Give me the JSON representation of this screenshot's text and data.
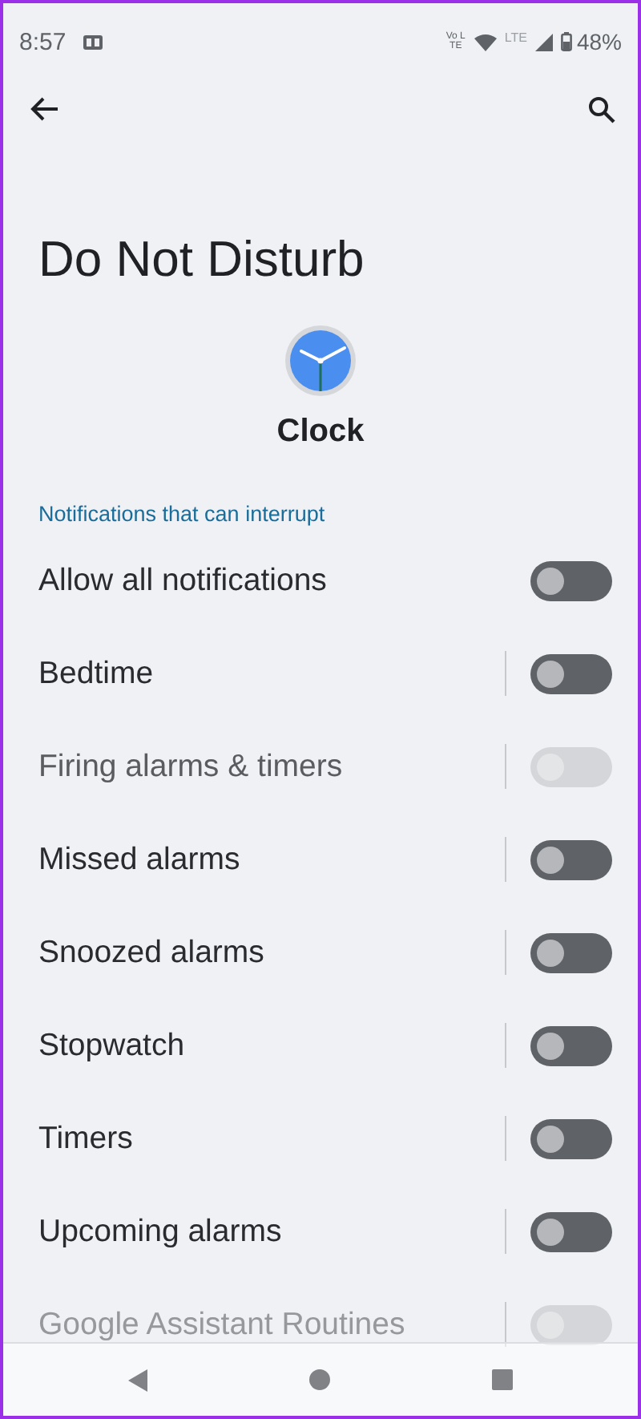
{
  "status_bar": {
    "time": "8:57",
    "volte": "Vo LTE",
    "lte": "LTE",
    "battery": "48%"
  },
  "title": "Do Not Disturb",
  "app": {
    "name": "Clock"
  },
  "section": "Notifications that can interrupt",
  "settings": [
    {
      "label": "Allow all notifications",
      "divider": false,
      "on": false,
      "disabled": false
    },
    {
      "label": "Bedtime",
      "divider": true,
      "on": false,
      "disabled": false
    },
    {
      "label": "Firing alarms & timers",
      "divider": true,
      "on": false,
      "disabled": true
    },
    {
      "label": "Missed alarms",
      "divider": true,
      "on": false,
      "disabled": false
    },
    {
      "label": "Snoozed alarms",
      "divider": true,
      "on": false,
      "disabled": false
    },
    {
      "label": "Stopwatch",
      "divider": true,
      "on": false,
      "disabled": false
    },
    {
      "label": "Timers",
      "divider": true,
      "on": false,
      "disabled": false
    },
    {
      "label": "Upcoming alarms",
      "divider": true,
      "on": false,
      "disabled": false
    },
    {
      "label": "Google Assistant Routines",
      "divider": true,
      "on": false,
      "disabled": true
    }
  ]
}
